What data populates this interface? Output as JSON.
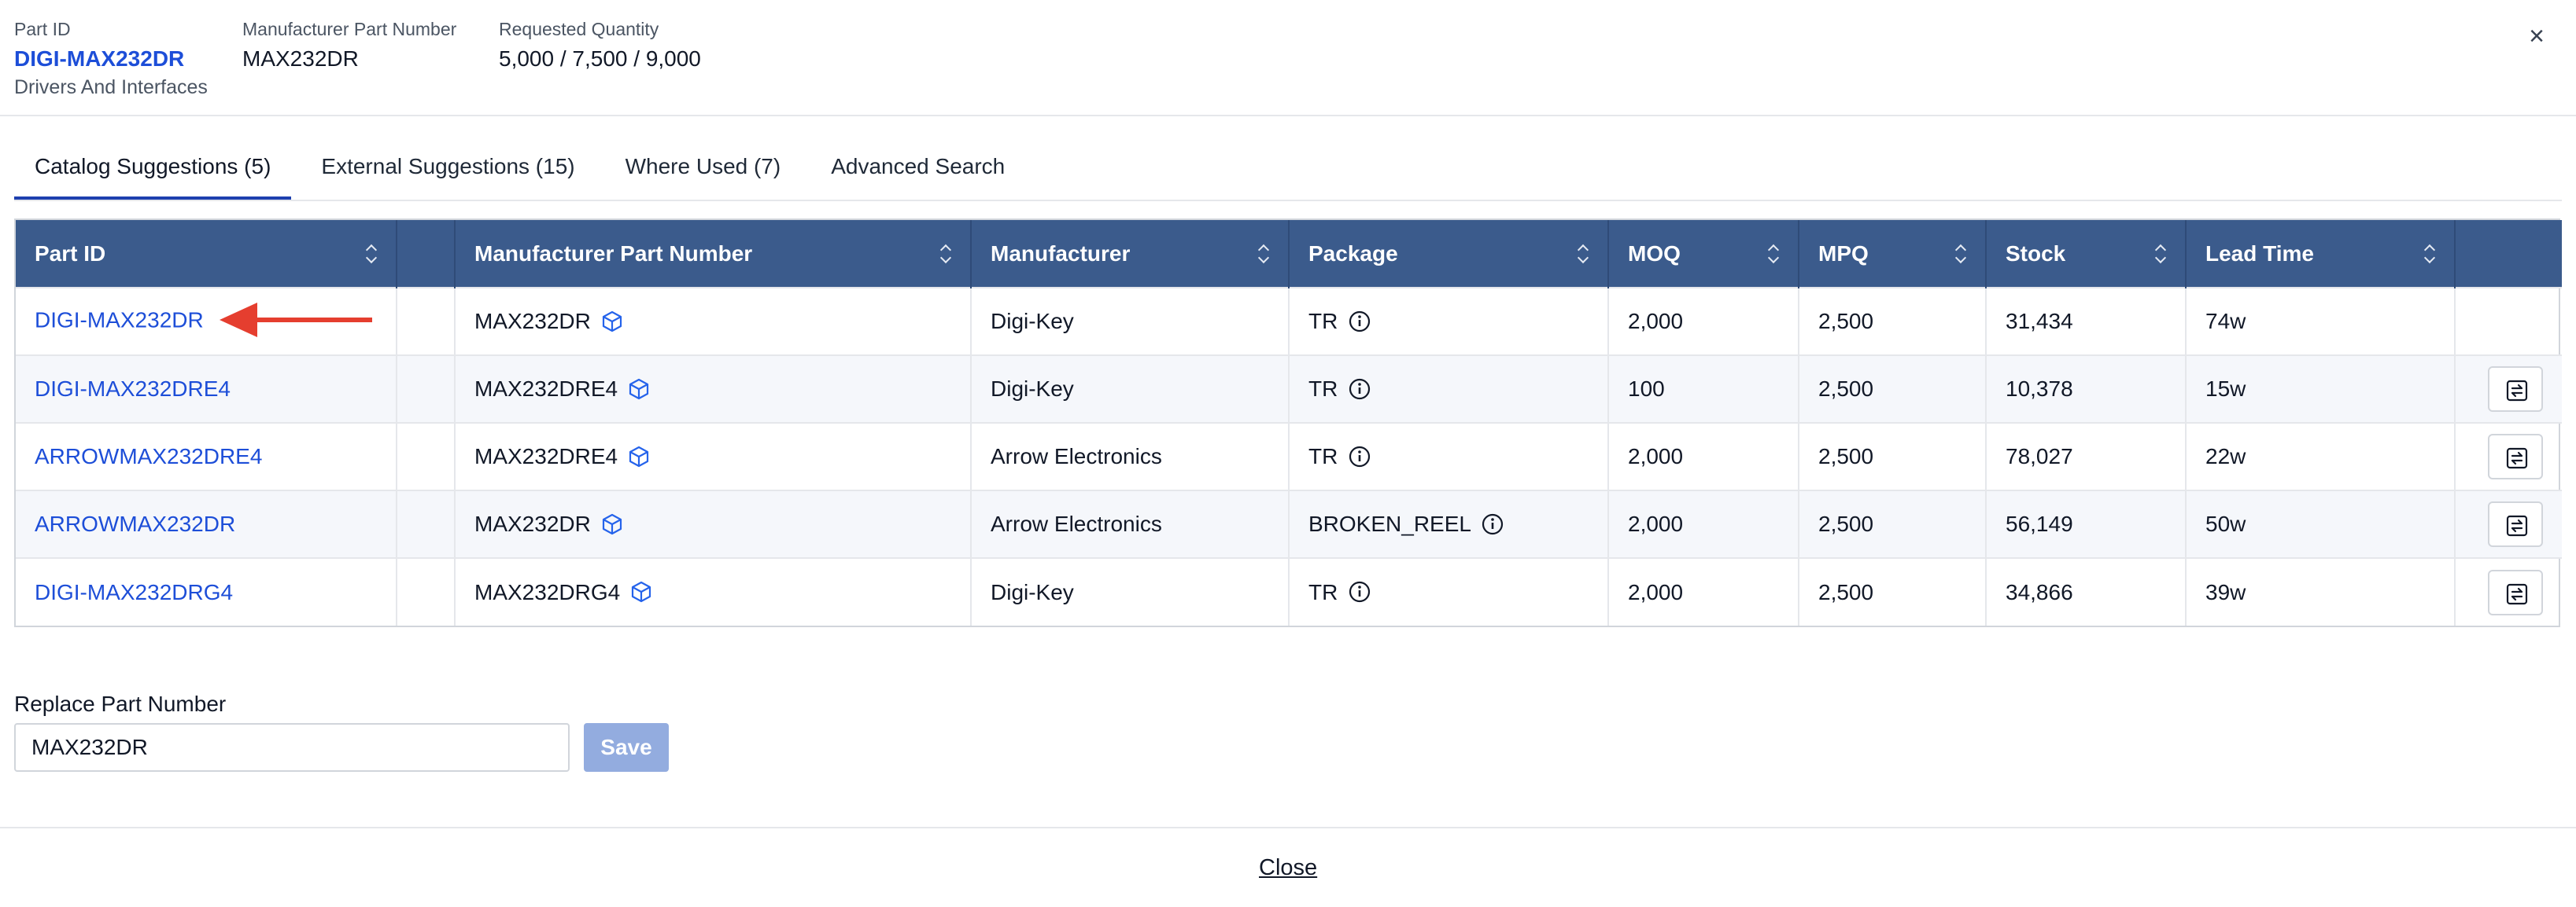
{
  "header": {
    "part_id_label": "Part ID",
    "part_id_value": "DIGI-MAX232DR",
    "part_category": "Drivers And Interfaces",
    "mpn_label": "Manufacturer Part Number",
    "mpn_value": "MAX232DR",
    "qty_label": "Requested Quantity",
    "qty_value": "5,000 / 7,500 / 9,000",
    "close_icon": "close-icon"
  },
  "tabs": [
    {
      "label": "Catalog Suggestions (5)",
      "active": true
    },
    {
      "label": "External Suggestions (15)",
      "active": false
    },
    {
      "label": "Where Used (7)",
      "active": false
    },
    {
      "label": "Advanced Search",
      "active": false
    }
  ],
  "table": {
    "columns": [
      "Part ID",
      "",
      "Manufacturer Part Number",
      "Manufacturer",
      "Package",
      "MOQ",
      "MPQ",
      "Stock",
      "Lead Time",
      ""
    ],
    "rows": [
      {
        "part_id": "DIGI-MAX232DR",
        "mpn": "MAX232DR",
        "manufacturer": "Digi-Key",
        "package": "TR",
        "moq": "2,000",
        "mpq": "2,500",
        "stock": "31,434",
        "lead_time": "74w"
      },
      {
        "part_id": "DIGI-MAX232DRE4",
        "mpn": "MAX232DRE4",
        "manufacturer": "Digi-Key",
        "package": "TR",
        "moq": "100",
        "mpq": "2,500",
        "stock": "10,378",
        "lead_time": "15w"
      },
      {
        "part_id": "ARROWMAX232DRE4",
        "mpn": "MAX232DRE4",
        "manufacturer": "Arrow Electronics",
        "package": "TR",
        "moq": "2,000",
        "mpq": "2,500",
        "stock": "78,027",
        "lead_time": "22w"
      },
      {
        "part_id": "ARROWMAX232DR",
        "mpn": "MAX232DR",
        "manufacturer": "Arrow Electronics",
        "package": "BROKEN_REEL",
        "moq": "2,000",
        "mpq": "2,500",
        "stock": "56,149",
        "lead_time": "50w"
      },
      {
        "part_id": "DIGI-MAX232DRG4",
        "mpn": "MAX232DRG4",
        "manufacturer": "Digi-Key",
        "package": "TR",
        "moq": "2,000",
        "mpq": "2,500",
        "stock": "34,866",
        "lead_time": "39w"
      }
    ]
  },
  "replace": {
    "label": "Replace Part Number",
    "value": "MAX232DR",
    "save_label": "Save"
  },
  "footer": {
    "close_label": "Close"
  },
  "colors": {
    "header_bg": "#3b5b8c",
    "link": "#1d4ed8",
    "arrow": "#e53e2f",
    "save_disabled": "#93acdf"
  }
}
